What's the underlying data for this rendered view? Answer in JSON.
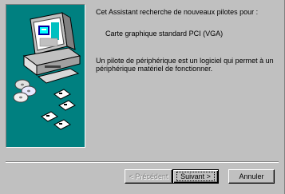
{
  "wizard": {
    "intro": "Cet Assistant recherche de nouveaux pilotes pour :",
    "device": "Carte graphique standard PCI (VGA)",
    "desc_line1": "Un pilote de périphérique est un logiciel qui permet à un",
    "desc_line2": "périphérique matériel de fonctionner."
  },
  "buttons": {
    "previous": "< Précédent",
    "next": "Suivant >",
    "cancel": "Annuler"
  },
  "colors": {
    "illustration_bg": "#008080",
    "dialog_bg": "#c0c0c0"
  },
  "icons": [
    "computer-icon",
    "cd-icon",
    "floppy-disk-icon"
  ]
}
